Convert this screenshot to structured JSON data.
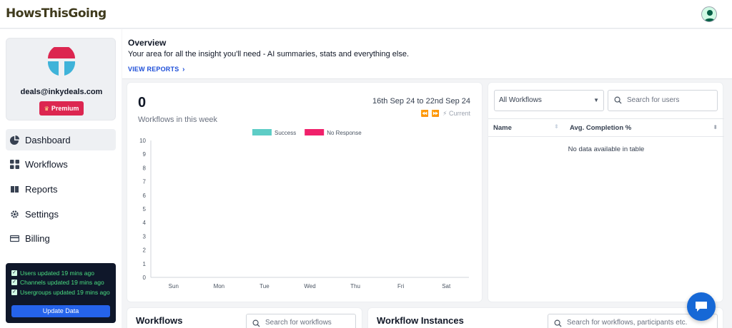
{
  "app": {
    "logo_text": "HowsThisGoing"
  },
  "sidebar": {
    "email": "deals@inkydeals.com",
    "badge": "Premium",
    "nav": [
      {
        "label": "Dashboard",
        "icon": "pie-chart-icon",
        "active": true
      },
      {
        "label": "Workflows",
        "icon": "grid-icon"
      },
      {
        "label": "Reports",
        "icon": "book-icon"
      },
      {
        "label": "Settings",
        "icon": "gear-icon"
      },
      {
        "label": "Billing",
        "icon": "credit-card-icon"
      }
    ],
    "status": [
      "Users updated 19 mins ago",
      "Channels updated 19 mins ago",
      "Usergroups updated 19 mins ago"
    ],
    "update_button": "Update Data"
  },
  "overview": {
    "title": "Overview",
    "subtitle": "Your area for all the insight you'll need - AI summaries, stats and everything else.",
    "link": "VIEW REPORTS"
  },
  "stats": {
    "count": "0",
    "caption": "Workflows in this week",
    "date_range": "16th Sep 24 to 22nd Sep 24",
    "current_label": "Current"
  },
  "chart_data": {
    "type": "bar",
    "categories": [
      "Sun",
      "Mon",
      "Tue",
      "Wed",
      "Thu",
      "Fri",
      "Sat"
    ],
    "series": [
      {
        "name": "Success",
        "color": "#5ecdc6",
        "values": [
          0,
          0,
          0,
          0,
          0,
          0,
          0
        ]
      },
      {
        "name": "No Response",
        "color": "#f0216b",
        "values": [
          0,
          0,
          0,
          0,
          0,
          0,
          0
        ]
      }
    ],
    "ylim": [
      0,
      10
    ],
    "yticks": [
      "0",
      "1",
      "2",
      "3",
      "4",
      "5",
      "6",
      "7",
      "8",
      "9",
      "10"
    ],
    "legend": "top"
  },
  "table": {
    "filter_value": "All Workflows",
    "search_placeholder": "Search for users",
    "columns": [
      "Name",
      "Avg. Completion %"
    ],
    "empty_text": "No data available in table"
  },
  "workflows": {
    "title": "Workflows",
    "search_placeholder": "Search for workflows"
  },
  "instances": {
    "title": "Workflow Instances",
    "search_placeholder": "Search for workflows, participants etc."
  }
}
